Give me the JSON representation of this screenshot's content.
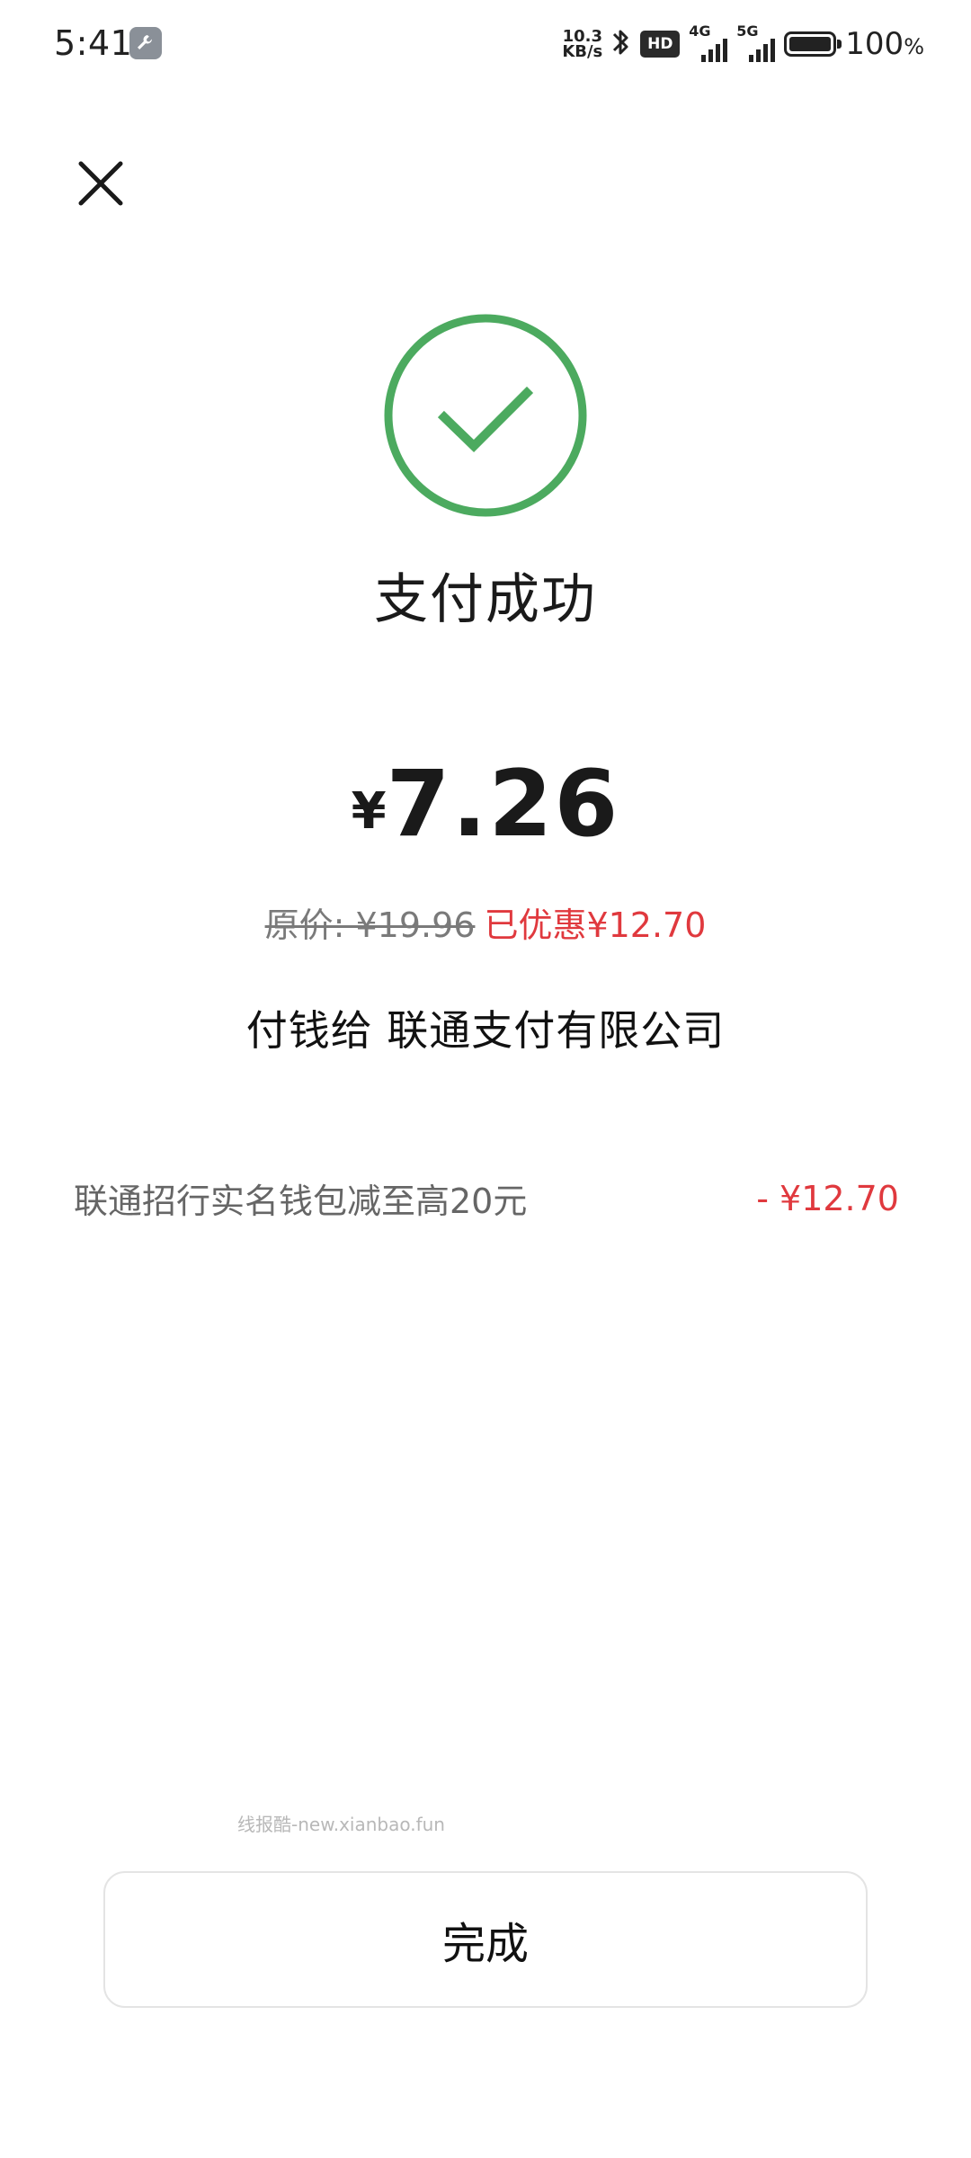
{
  "status_bar": {
    "time": "5:41",
    "net_speed_value": "10.3",
    "net_speed_unit": "KB/s",
    "hd_label": "HD",
    "sim1_label": "4G",
    "sim2_label": "5G",
    "battery_level": 100,
    "battery_text": "100",
    "battery_unit": "%",
    "icons": [
      "tool-icon",
      "bluetooth-icon",
      "hd-icon",
      "signal-icon",
      "battery-icon"
    ]
  },
  "header": {
    "close_icon": "close-icon"
  },
  "result": {
    "icon": "checkmark-circle-icon",
    "icon_color": "#4CAA5F",
    "title": "支付成功",
    "currency_symbol": "¥",
    "amount": "7.26",
    "original_price": "原价: ¥19.96",
    "discount_text": "已优惠¥12.70",
    "payee": "付钱给 联通支付有限公司"
  },
  "promotions": [
    {
      "label": "联通招行实名钱包减至高20元",
      "amount": "- ¥12.70"
    }
  ],
  "watermark": "线报酷-new.xianbao.fun",
  "actions": {
    "done_label": "完成"
  },
  "colors": {
    "success": "#4CAA5F",
    "discount_red": "#E0393E",
    "text_primary": "#1A1A1A",
    "text_secondary": "#666666"
  }
}
